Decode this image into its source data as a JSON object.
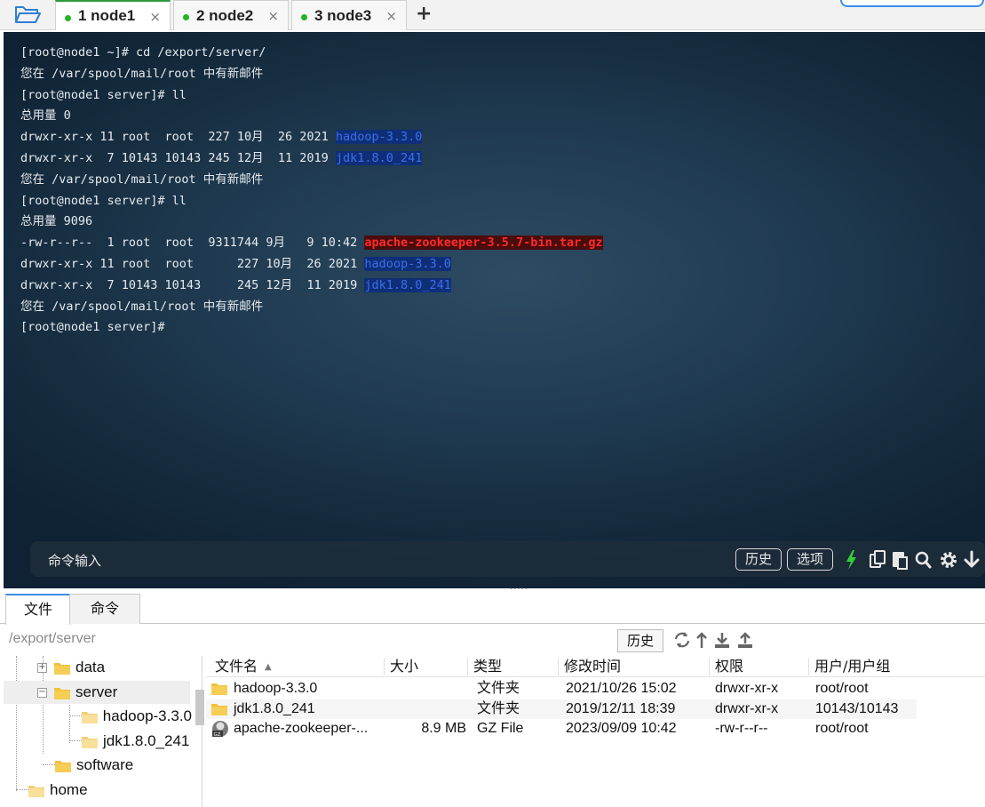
{
  "tabs": [
    {
      "label": "1 node1",
      "active": true
    },
    {
      "label": "2 node2",
      "active": false
    },
    {
      "label": "3 node3",
      "active": false
    }
  ],
  "tab_close_glyph": "×",
  "tab_add_glyph": "+",
  "terminal": {
    "lines": [
      {
        "text": "[root@node1 ~]# cd /export/server/"
      },
      {
        "text": "您在 /var/spool/mail/root 中有新邮件"
      },
      {
        "text": "[root@node1 server]# ll"
      },
      {
        "text": "总用量 0"
      },
      {
        "text": "drwxr-xr-x 11 root  root  227 10月  26 2021 ",
        "hl": "hadoop-3.3.0",
        "hl_color": "blue"
      },
      {
        "text": "drwxr-xr-x  7 10143 10143 245 12月  11 2019 ",
        "hl": "jdk1.8.0_241",
        "hl_color": "blue"
      },
      {
        "text": "您在 /var/spool/mail/root 中有新邮件"
      },
      {
        "text": "[root@node1 server]# ll"
      },
      {
        "text": "总用量 9096"
      },
      {
        "text": "-rw-r--r--  1 root  root  9311744 9月   9 10:42 ",
        "hl": "apache-zookeeper-3.5.7-bin.tar.gz",
        "hl_color": "red"
      },
      {
        "text": "drwxr-xr-x 11 root  root      227 10月  26 2021 ",
        "hl": "hadoop-3.3.0",
        "hl_color": "blue"
      },
      {
        "text": "drwxr-xr-x  7 10143 10143     245 12月  11 2019 ",
        "hl": "jdk1.8.0_241",
        "hl_color": "blue"
      },
      {
        "text": "您在 /var/spool/mail/root 中有新邮件"
      },
      {
        "text": "[root@node1 server]#"
      }
    ],
    "command_input_placeholder": "命令输入",
    "history_button": "历史",
    "options_button": "选项"
  },
  "bottom_tabs": [
    {
      "label": "文件",
      "active": true
    },
    {
      "label": "命令",
      "active": false
    }
  ],
  "path": "/export/server",
  "path_history_button": "历史",
  "tree": [
    {
      "label": "data",
      "toggle": "+",
      "level": 1
    },
    {
      "label": "server",
      "toggle": "−",
      "level": 1,
      "selected": true
    },
    {
      "label": "hadoop-3.3.0",
      "level": 2
    },
    {
      "label": "jdk1.8.0_241",
      "level": 2
    },
    {
      "label": "software",
      "level": 1
    },
    {
      "label": "home",
      "level": 0
    }
  ],
  "file_list": {
    "columns": [
      "文件名",
      "大小",
      "类型",
      "修改时间",
      "权限",
      "用户/用户组"
    ],
    "sort_indicator": "▲",
    "rows": [
      {
        "name": "hadoop-3.3.0",
        "size": "",
        "type": "文件夹",
        "modified": "2021/10/26 15:02",
        "perm": "drwxr-xr-x",
        "owner": "root/root",
        "icon": "folder-icon"
      },
      {
        "name": "jdk1.8.0_241",
        "size": "",
        "type": "文件夹",
        "modified": "2019/12/11 18:39",
        "perm": "drwxr-xr-x",
        "owner": "10143/10143",
        "icon": "folder-icon"
      },
      {
        "name": "apache-zookeeper-...",
        "size": "8.9 MB",
        "type": "GZ File",
        "modified": "2023/09/09 10:42",
        "perm": "-rw-r--r--",
        "owner": "root/root",
        "icon": "gz-file-icon"
      }
    ]
  },
  "colors": {
    "terminal_bg": "#1f3a50",
    "link_blue": "#3e6ee8",
    "archive_red": "#ff2a2a",
    "status_green": "#22b422",
    "folder_yellow": "#f3c03a"
  }
}
